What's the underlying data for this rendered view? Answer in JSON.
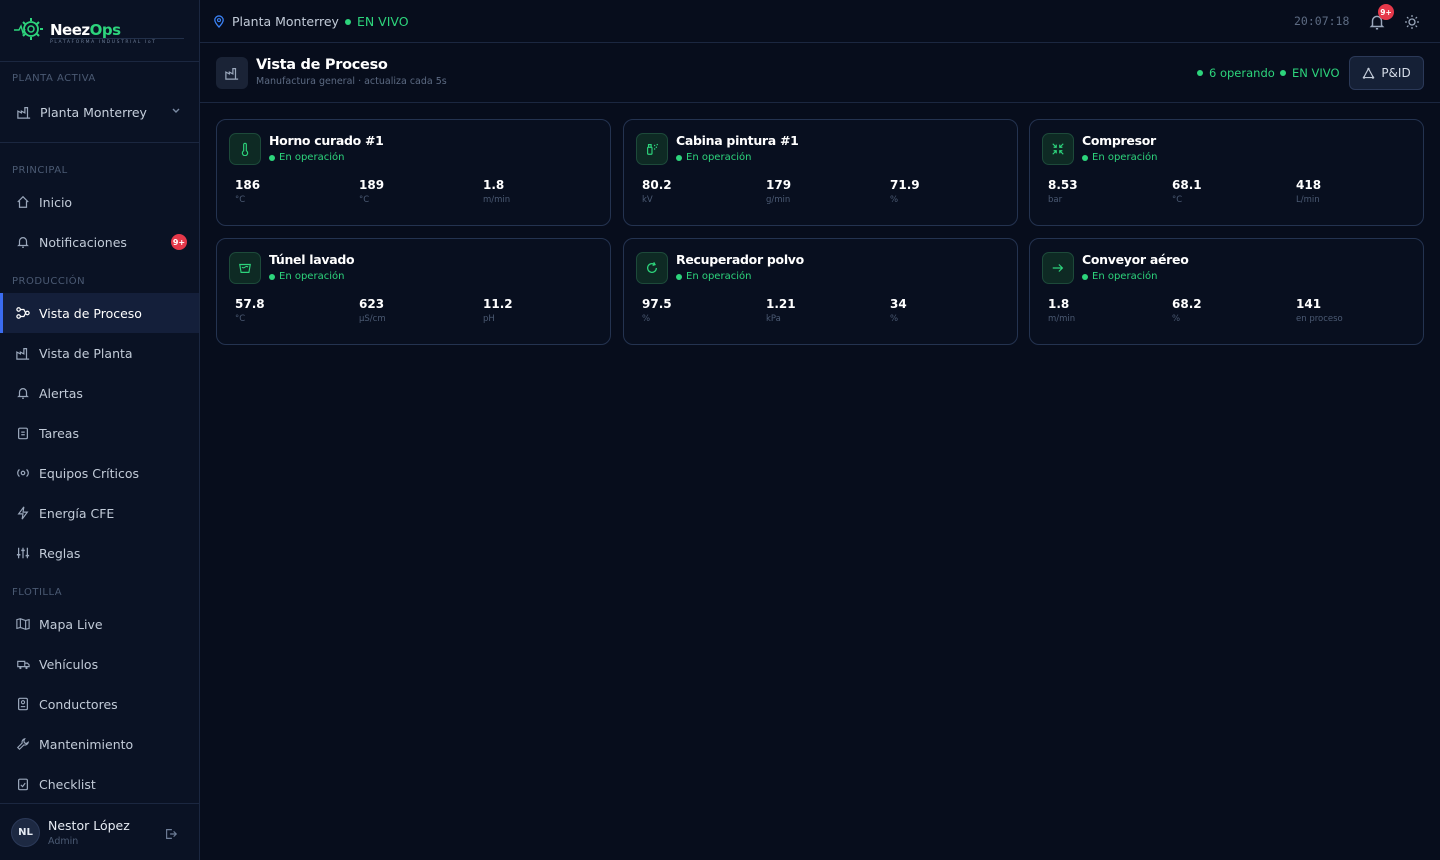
{
  "brand": {
    "name_a": "Neez",
    "name_b": "Ops",
    "tagline": "PLATAFORMA INDUSTRIAL IoT",
    "accent": "#2dd47c"
  },
  "sidebar": {
    "plant_section": "PLANTA ACTIVA",
    "plant_selected": "Planta Monterrey",
    "sections": {
      "principal": "PRINCIPAL",
      "produccion": "PRODUCCIÓN",
      "flotilla": "FLOTILLA"
    },
    "items": [
      {
        "label": "Inicio",
        "icon": "home-icon"
      },
      {
        "label": "Notificaciones",
        "icon": "bell-icon",
        "badge": "9+"
      },
      {
        "label": "Vista de Proceso",
        "icon": "process-icon",
        "active": true
      },
      {
        "label": "Vista de Planta",
        "icon": "factory-icon"
      },
      {
        "label": "Alertas",
        "icon": "bell-icon"
      },
      {
        "label": "Tareas",
        "icon": "clipboard-icon"
      },
      {
        "label": "Equipos Críticos",
        "icon": "gear-icon"
      },
      {
        "label": "Energía CFE",
        "icon": "bolt-icon"
      },
      {
        "label": "Reglas",
        "icon": "sliders-icon"
      },
      {
        "label": "Mapa Live",
        "icon": "map-icon"
      },
      {
        "label": "Vehículos",
        "icon": "truck-icon"
      },
      {
        "label": "Conductores",
        "icon": "id-card-icon"
      },
      {
        "label": "Mantenimiento",
        "icon": "wrench-icon"
      },
      {
        "label": "Checklist",
        "icon": "checklist-icon"
      }
    ],
    "user": {
      "initials": "NL",
      "name": "Nestor López",
      "role": "Admin"
    }
  },
  "topbar": {
    "location": "Planta Monterrey",
    "live": "EN VIVO",
    "clock": "20:07:18",
    "bell_badge": "9+"
  },
  "header": {
    "title": "Vista de Proceso",
    "subtitle": "Manufactura general · actualiza cada 5s",
    "operating": "6 operando",
    "live": "EN VIVO",
    "pid_button": "P&ID"
  },
  "cards": [
    {
      "title": "Horno curado #1",
      "status": "En operación",
      "icon": "thermometer-icon",
      "metrics": [
        {
          "value": "186",
          "unit": "°C"
        },
        {
          "value": "189",
          "unit": "°C"
        },
        {
          "value": "1.8",
          "unit": "m/min"
        }
      ]
    },
    {
      "title": "Cabina pintura #1",
      "status": "En operación",
      "icon": "spray-icon",
      "metrics": [
        {
          "value": "80.2",
          "unit": "kV"
        },
        {
          "value": "179",
          "unit": "g/min"
        },
        {
          "value": "71.9",
          "unit": "%"
        }
      ]
    },
    {
      "title": "Compresor",
      "status": "En operación",
      "icon": "compress-icon",
      "metrics": [
        {
          "value": "8.53",
          "unit": "bar"
        },
        {
          "value": "68.1",
          "unit": "°C"
        },
        {
          "value": "418",
          "unit": "L/min"
        }
      ]
    },
    {
      "title": "Túnel lavado",
      "status": "En operación",
      "icon": "washer-icon",
      "metrics": [
        {
          "value": "57.8",
          "unit": "°C"
        },
        {
          "value": "623",
          "unit": "µS/cm"
        },
        {
          "value": "11.2",
          "unit": "pH"
        }
      ]
    },
    {
      "title": "Recuperador polvo",
      "status": "En operación",
      "icon": "recycle-icon",
      "metrics": [
        {
          "value": "97.5",
          "unit": "%"
        },
        {
          "value": "1.21",
          "unit": "kPa"
        },
        {
          "value": "34",
          "unit": "%"
        }
      ]
    },
    {
      "title": "Conveyor aéreo",
      "status": "En operación",
      "icon": "arrow-right-icon",
      "metrics": [
        {
          "value": "1.8",
          "unit": "m/min"
        },
        {
          "value": "68.2",
          "unit": "%"
        },
        {
          "value": "141",
          "unit": "en proceso"
        }
      ]
    }
  ]
}
